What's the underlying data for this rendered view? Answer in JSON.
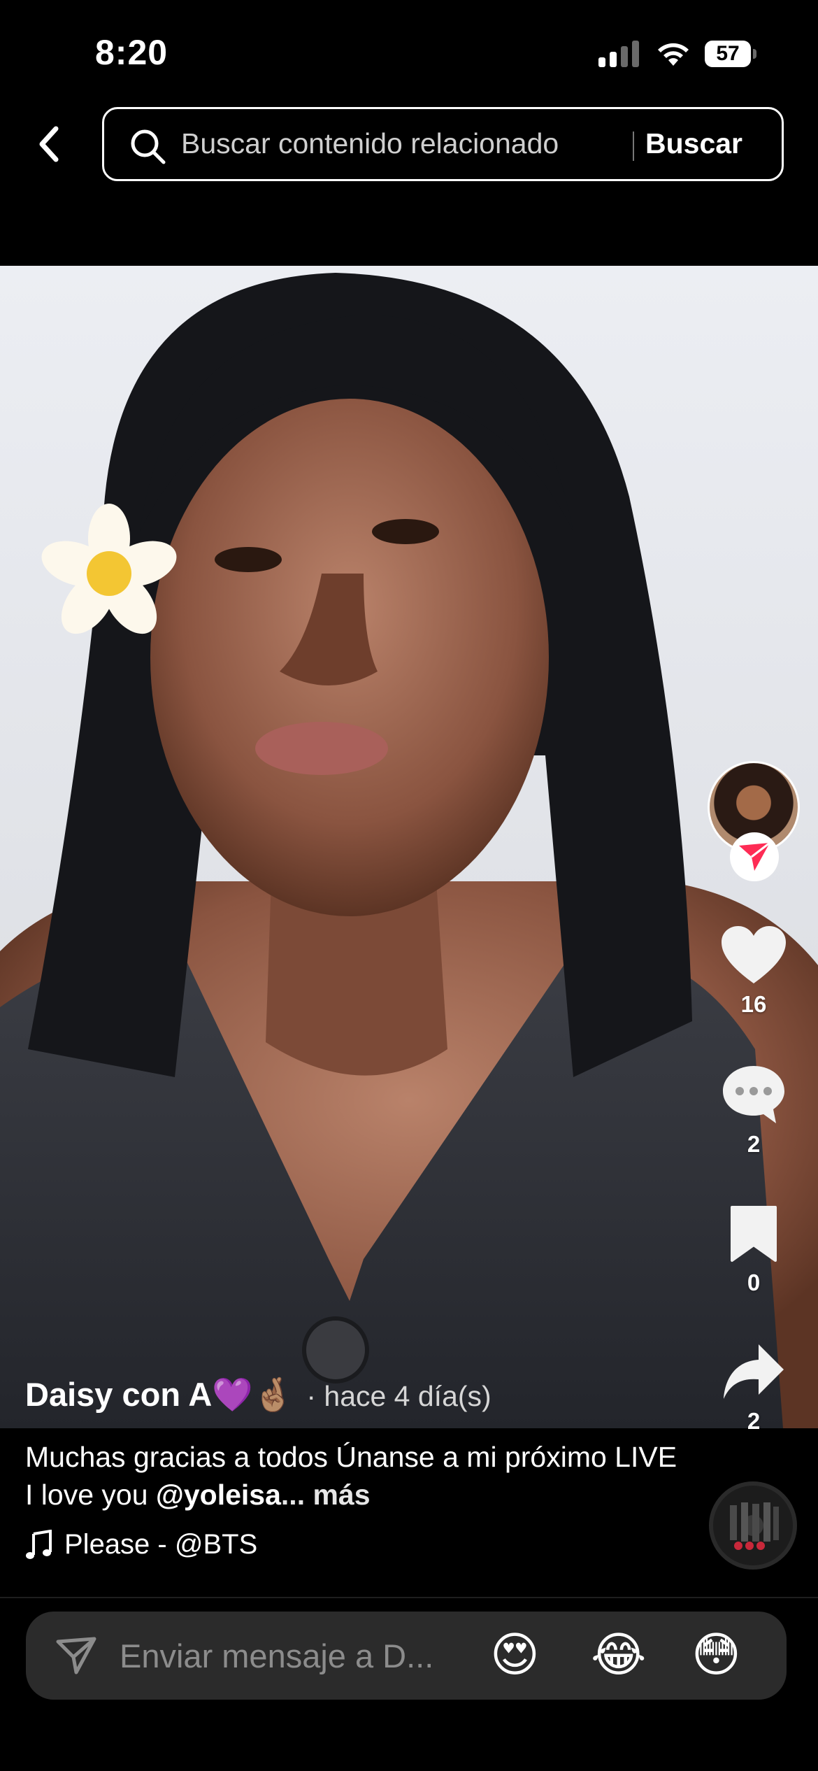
{
  "status_bar": {
    "time": "8:20",
    "battery": "57"
  },
  "search": {
    "placeholder": "Buscar contenido relacionado",
    "button_label": "Buscar"
  },
  "video": {
    "author": "Daisy con A💜🤞🏽",
    "time_ago": "· hace 4 día(s)",
    "caption_text": "Muchas gracias a todos Únanse a mi próximo LIVE I love you ",
    "caption_mention": "@yoleisa",
    "caption_more": "... más",
    "music": "Please - @BTS"
  },
  "actions": {
    "likes": "16",
    "comments": "2",
    "saves": "0",
    "shares": "2"
  },
  "message_bar": {
    "placeholder": "Enviar mensaje a D...",
    "emojis": [
      "😍",
      "😂",
      "😳"
    ]
  },
  "colors": {
    "accent": "#fe2c55",
    "background": "#000000",
    "input_background": "#2b2b2b"
  },
  "icons": [
    "back-chevron-icon",
    "search-icon",
    "heart-icon",
    "comment-icon",
    "bookmark-icon",
    "share-icon",
    "music-note-icon",
    "send-icon",
    "follow-icon"
  ]
}
